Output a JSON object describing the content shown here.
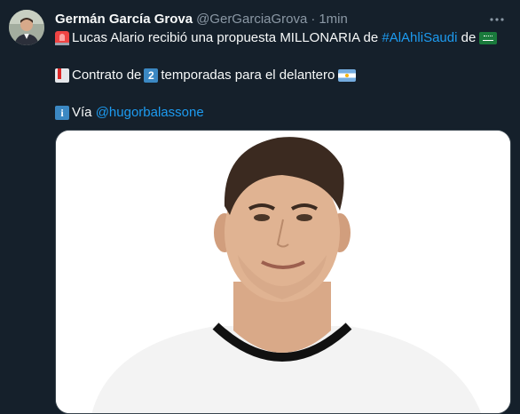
{
  "tweet": {
    "author": {
      "name": "Germán García Grova",
      "handle": "@GerGarciaGrova",
      "separator": "·",
      "time": "1min"
    },
    "icons": {
      "more": "more-options-icon",
      "avatar": "profile-avatar"
    },
    "text": {
      "line1_part1": "Lucas Alario recibió una propuesta MILLONARIA de",
      "line1_hashtag": "#AlAhliSaudi",
      "line1_part2": "de",
      "line2_part1": "Contrato de",
      "line2_number": "2",
      "line2_part2": "temporadas para el delantero",
      "line3_label": "Vía",
      "line3_mention": "@hugorbalassone"
    },
    "emojis": [
      "police-car-light",
      "bookmark-tabs",
      "keycap-2",
      "info",
      "flag-saudi-arabia",
      "flag-argentina"
    ],
    "colors": {
      "background": "#15202b",
      "text": "#f7f9f9",
      "secondary": "#8b98a5",
      "link": "#1d9bf0"
    }
  }
}
